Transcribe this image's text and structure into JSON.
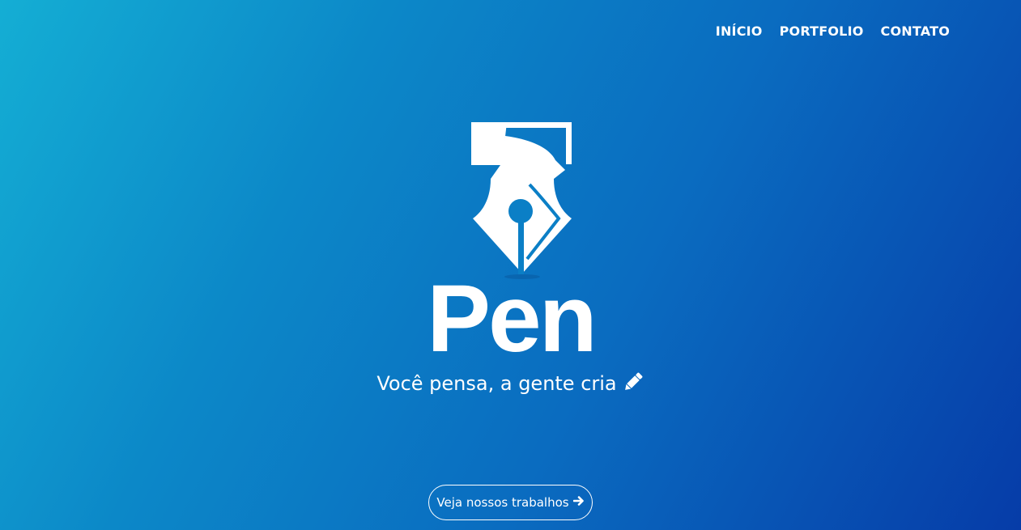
{
  "nav": {
    "items": [
      {
        "label": "INÍCIO"
      },
      {
        "label": "PORTFOLIO"
      },
      {
        "label": "CONTATO"
      }
    ]
  },
  "hero": {
    "logo_text": "Pen",
    "tagline": "Você pensa, a gente cria",
    "tagline_icon": "pencil-icon",
    "cta_label": "Veja nossos trabalhos",
    "cta_icon": "arrow-right-icon"
  },
  "colors": {
    "gradient_start": "#14aed4",
    "gradient_end": "#063ca8",
    "foreground": "#ffffff"
  }
}
